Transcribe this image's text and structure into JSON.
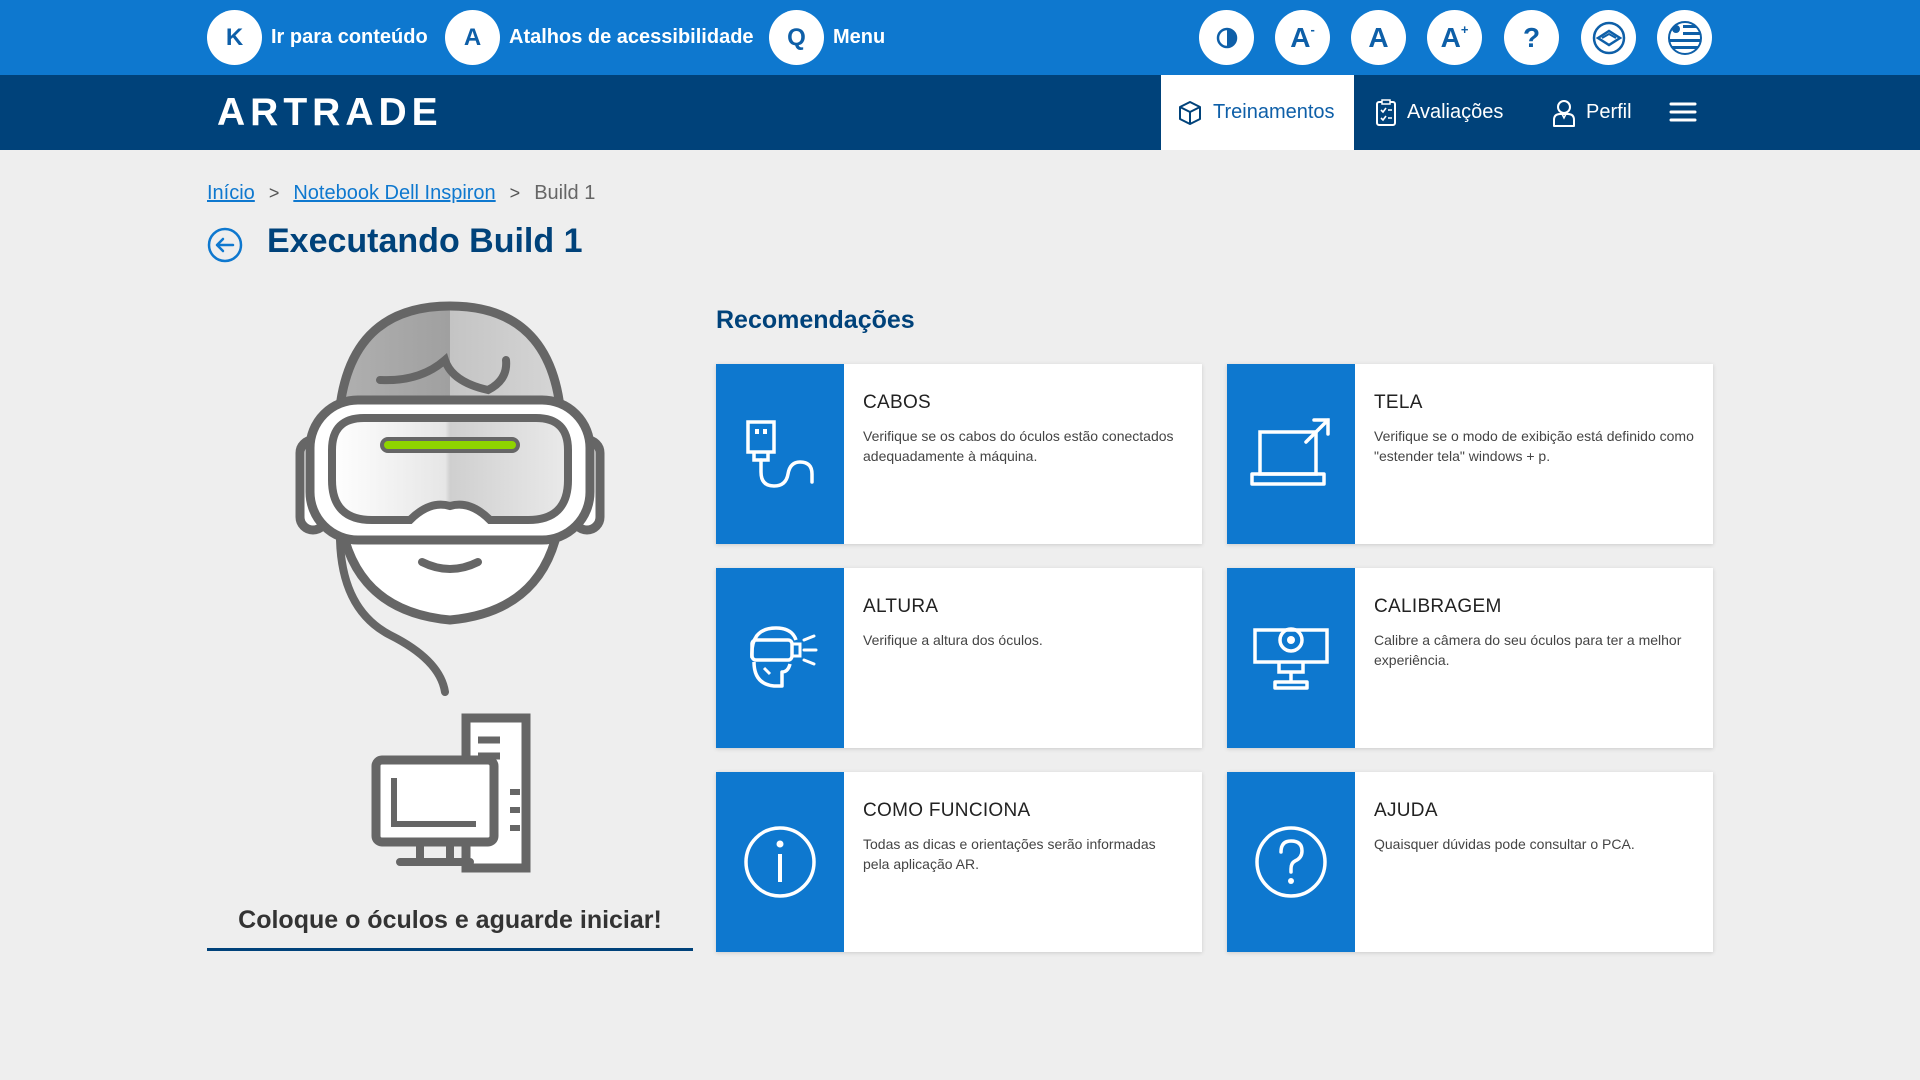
{
  "a11y": {
    "skip_content": {
      "key": "K",
      "label": "Ir para conteúdo"
    },
    "shortcuts": {
      "key": "A",
      "label": "Atalhos de acessibilidade"
    },
    "menu": {
      "key": "Q",
      "label": "Menu"
    },
    "tools": {
      "contrast": "contrast-icon",
      "font_decrease": "A",
      "font_decrease_mark": "-",
      "font_normal": "A",
      "font_increase": "A",
      "font_increase_mark": "+",
      "help": "?",
      "libras": "libras-icon",
      "language": "flag-uruguay-icon"
    }
  },
  "nav": {
    "brand": "ARTRADE",
    "items": [
      {
        "label": "Treinamentos",
        "icon": "cube-icon",
        "active": true
      },
      {
        "label": "Avaliações",
        "icon": "checklist-icon",
        "active": false
      },
      {
        "label": "Perfil",
        "icon": "user-icon",
        "active": false
      }
    ],
    "menu_icon": "hamburger-icon"
  },
  "breadcrumb": {
    "items": [
      "Início",
      "Notebook Dell Inspiron",
      "Build 1"
    ],
    "separator": ">"
  },
  "page": {
    "title": "Executando Build 1",
    "caption": "Coloque o óculos e aguarde iniciar!"
  },
  "recommendations": {
    "title": "Recomendações",
    "cards": [
      {
        "title": "CABOS",
        "text": "Verifique se os cabos do óculos estão conectados adequadamente à máquina.",
        "icon": "usb-cable-icon"
      },
      {
        "title": "TELA",
        "text": "Verifique se o modo de exibição está definido como \"estender tela\" windows + p.",
        "icon": "laptop-extend-icon"
      },
      {
        "title": "ALTURA",
        "text": "Verifique a altura dos óculos.",
        "icon": "vr-head-icon"
      },
      {
        "title": "CALIBRAGEM",
        "text": "Calibre a câmera do seu óculos para ter a melhor experiência.",
        "icon": "webcam-icon"
      },
      {
        "title": "COMO FUNCIONA",
        "text": "Todas as dicas e orientações serão informadas pela aplicação AR.",
        "icon": "info-icon"
      },
      {
        "title": "AJUDA",
        "text": "Quaisquer dúvidas pode consultar o PCA.",
        "icon": "question-icon"
      }
    ]
  },
  "colors": {
    "accent": "#0e78cf",
    "nav": "#00427a",
    "background": "#eeeeee",
    "visor_light": "#8fd400"
  }
}
